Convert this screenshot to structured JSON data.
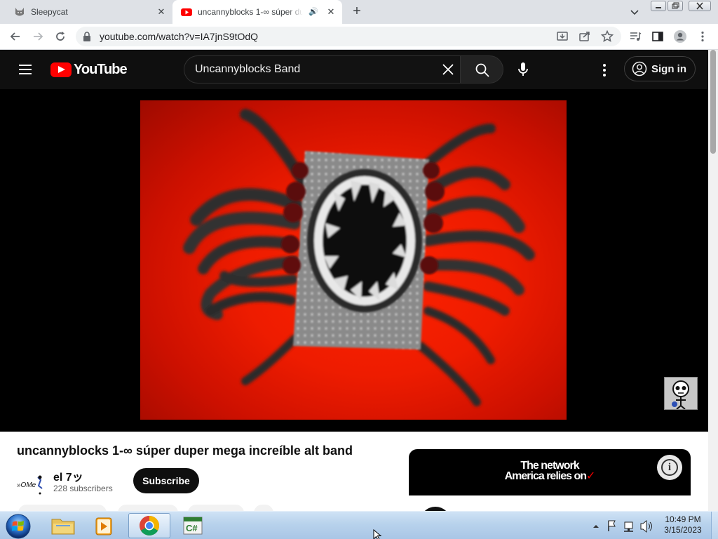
{
  "browser": {
    "tabs": [
      {
        "title": "Sleepycat",
        "active": false
      },
      {
        "title": "uncannyblocks 1-∞ súper du",
        "active": true,
        "playing_audio": true
      }
    ],
    "url": "youtube.com/watch?v=IA7jnS9tOdQ"
  },
  "youtube": {
    "logo_text": "YouTube",
    "search_query": "Uncannyblocks Band",
    "sign_in_label": "Sign in",
    "video": {
      "title": "uncannyblocks 1-∞ súper duper mega increíble alt band"
    },
    "channel": {
      "name": "el 7ッ",
      "subscribers": "228 subscribers",
      "subscribe_label": "Subscribe"
    },
    "ad": {
      "line1": "The network",
      "line2": "America relies on"
    }
  },
  "taskbar": {
    "time": "10:49 PM",
    "date": "3/15/2023",
    "apps": [
      "file-explorer",
      "media-player",
      "chrome",
      "csharp-editor"
    ]
  },
  "colors": {
    "yt_red": "#ff0000",
    "yt_dark": "#0f0f0f",
    "video_bg": "#e81c00"
  }
}
